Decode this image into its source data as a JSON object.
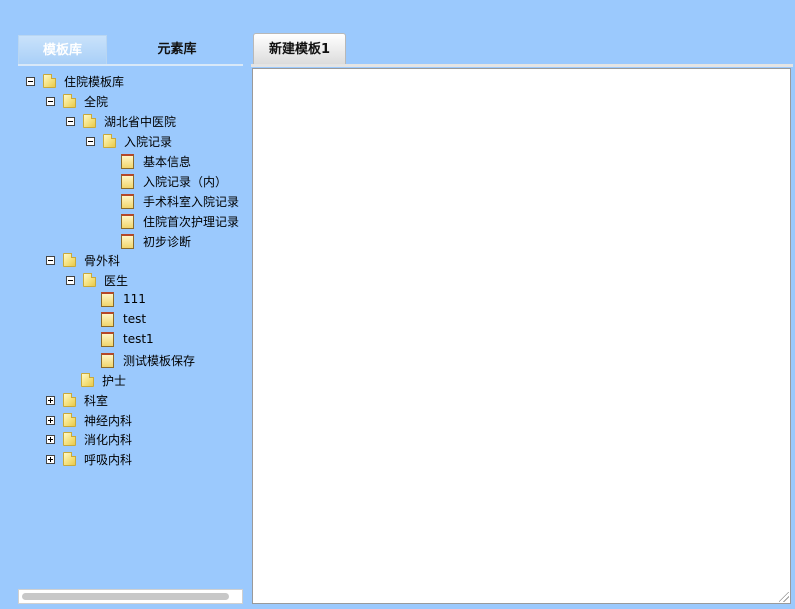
{
  "left_tabs": {
    "active": "模板库",
    "inactive": "元素库"
  },
  "tree": [
    {
      "label": "住院模板库",
      "type": "folder",
      "toggle": "minus"
    },
    {
      "label": "全院",
      "type": "folder",
      "toggle": "minus"
    },
    {
      "label": "湖北省中医院",
      "type": "folder",
      "toggle": "minus"
    },
    {
      "label": "入院记录",
      "type": "folder",
      "toggle": "minus"
    },
    {
      "label": "基本信息",
      "type": "doc",
      "toggle": "none"
    },
    {
      "label": "入院记录（内）",
      "type": "doc",
      "toggle": "none"
    },
    {
      "label": "手术科室入院记录",
      "type": "doc",
      "toggle": "none"
    },
    {
      "label": "住院首次护理记录",
      "type": "doc",
      "toggle": "none"
    },
    {
      "label": "初步诊断",
      "type": "doc",
      "toggle": "none"
    },
    {
      "label": "骨外科",
      "type": "folder",
      "toggle": "minus"
    },
    {
      "label": "医生",
      "type": "folder",
      "toggle": "minus"
    },
    {
      "label": "111",
      "type": "doc",
      "toggle": "none"
    },
    {
      "label": "test",
      "type": "doc",
      "toggle": "none"
    },
    {
      "label": "test1",
      "type": "doc",
      "toggle": "none"
    },
    {
      "label": "测试模板保存",
      "type": "doc",
      "toggle": "none"
    },
    {
      "label": "护士",
      "type": "folder",
      "toggle": "none"
    },
    {
      "label": "科室",
      "type": "folder",
      "toggle": "plus"
    },
    {
      "label": "神经内科",
      "type": "folder",
      "toggle": "plus"
    },
    {
      "label": "消化内科",
      "type": "folder",
      "toggle": "plus"
    },
    {
      "label": "呼吸内科",
      "type": "folder",
      "toggle": "plus"
    }
  ],
  "editor": {
    "tab_label": "新建模板1"
  }
}
